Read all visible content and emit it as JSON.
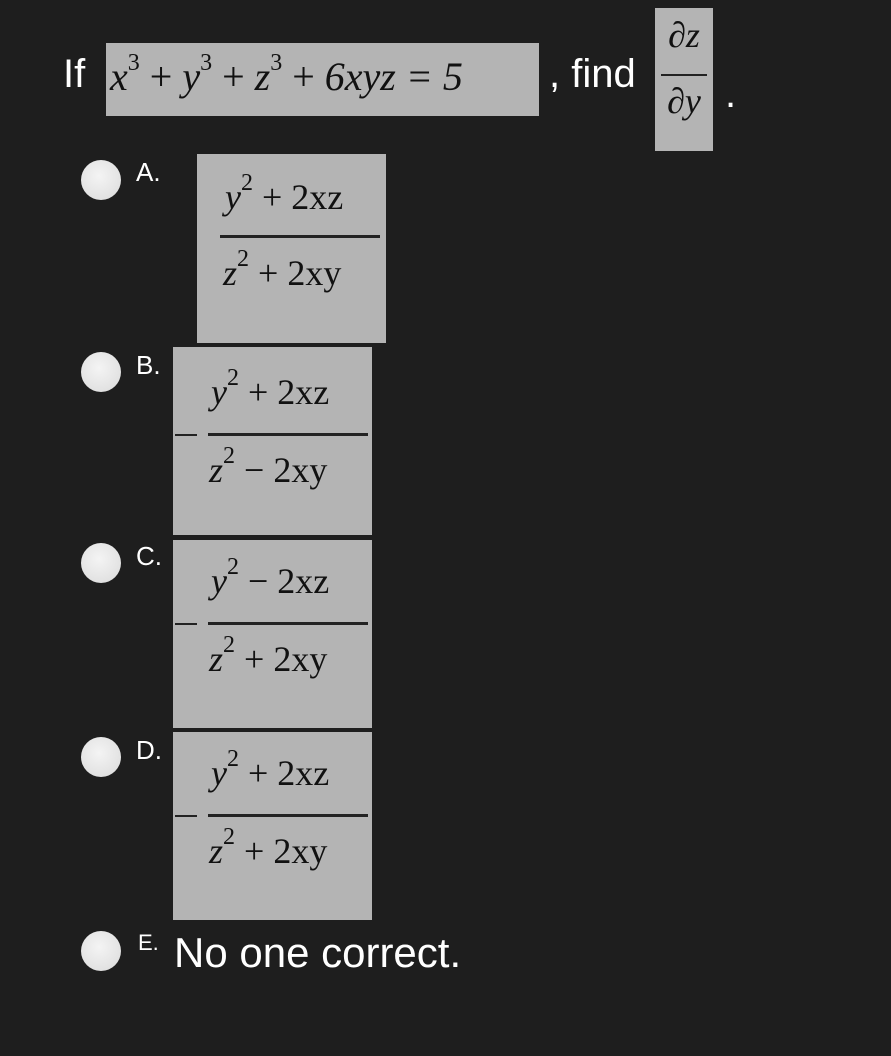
{
  "question": {
    "prefix": "If",
    "equation": {
      "x_term": "x",
      "y_term": "y",
      "z_term": "z",
      "exp": "3",
      "plus": "+",
      "rest": "6xyz = 5"
    },
    "suffix": ", find",
    "derivative": {
      "numerator": "∂z",
      "denominator": "∂y"
    },
    "end": "."
  },
  "options": [
    {
      "letter": "A.",
      "sign": "",
      "num": {
        "base": "y",
        "exp": "2",
        "rest": " + 2xz"
      },
      "den": {
        "base": "z",
        "exp": "2",
        "rest": " + 2xy"
      }
    },
    {
      "letter": "B.",
      "sign": "−",
      "num": {
        "base": "y",
        "exp": "2",
        "rest": " + 2xz"
      },
      "den": {
        "base": "z",
        "exp": "2",
        "rest": " − 2xy"
      }
    },
    {
      "letter": "C.",
      "sign": "−",
      "num": {
        "base": "y",
        "exp": "2",
        "rest": " − 2xz"
      },
      "den": {
        "base": "z",
        "exp": "2",
        "rest": " + 2xy"
      }
    },
    {
      "letter": "D.",
      "sign": "−",
      "num": {
        "base": "y",
        "exp": "2",
        "rest": " + 2xz"
      },
      "den": {
        "base": "z",
        "exp": "2",
        "rest": " + 2xy"
      }
    },
    {
      "letter": "E.",
      "text": "No one correct."
    }
  ],
  "colors": {
    "background": "#1e1e1e",
    "math_box": "#b4b4b4",
    "text": "#ffffff"
  }
}
